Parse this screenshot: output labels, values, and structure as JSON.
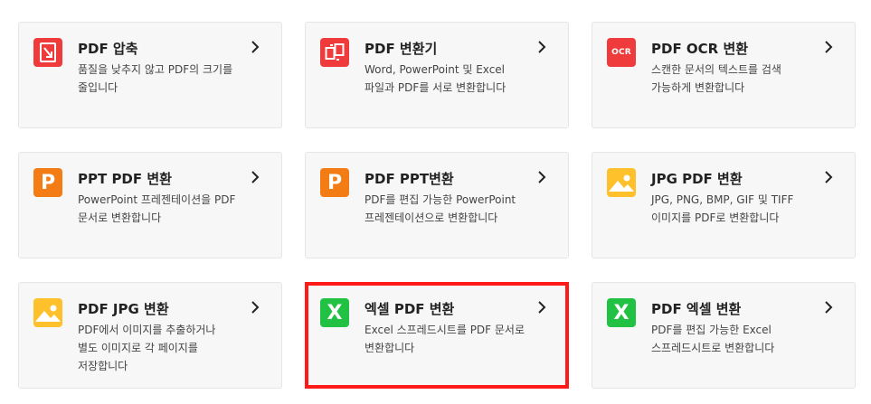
{
  "colors": {
    "red_icon": "#ef3b3b",
    "orange_icon": "#f47c14",
    "yellow_icon": "#ffc12b",
    "green_icon": "#21c243",
    "highlight_border": "#ff1a1a"
  },
  "cards": [
    {
      "title": "PDF 압축",
      "description": "품질을 낮추지 않고 PDF의 크기를 줄입니다",
      "icon": "compress-icon",
      "icon_color": "red"
    },
    {
      "title": "PDF 변환기",
      "description": "Word, PowerPoint 및 Excel 파일과 PDF를 서로 변환합니다",
      "icon": "convert-icon",
      "icon_color": "red"
    },
    {
      "title": "PDF OCR 변환",
      "description": "스캔한 문서의 텍스트를 검색 가능하게 변환합니다",
      "icon": "ocr-icon",
      "icon_color": "red",
      "icon_text": "OCR"
    },
    {
      "title": "PPT PDF 변환",
      "description": "PowerPoint 프레젠테이션을 PDF 문서로 변환합니다",
      "icon": "powerpoint-icon",
      "icon_color": "orange",
      "icon_text": "P"
    },
    {
      "title": "PDF PPT변환",
      "description": "PDF를 편집 가능한 PowerPoint 프레젠테이션으로 변환합니다",
      "icon": "powerpoint-icon",
      "icon_color": "orange",
      "icon_text": "P"
    },
    {
      "title": "JPG PDF 변환",
      "description": "JPG, PNG, BMP, GIF 및 TIFF 이미지를 PDF로 변환합니다",
      "icon": "image-icon",
      "icon_color": "yellow"
    },
    {
      "title": "PDF JPG 변환",
      "description": "PDF에서 이미지를 추출하거나 별도 이미지로 각 페이지를 저장합니다",
      "icon": "image-icon",
      "icon_color": "yellow"
    },
    {
      "title": "엑셀 PDF 변환",
      "description": "Excel 스프레드시트를 PDF 문서로 변환합니다",
      "icon": "excel-icon",
      "icon_color": "green",
      "icon_text": "X",
      "highlighted": true
    },
    {
      "title": "PDF 엑셀 변환",
      "description": "PDF를 편집 가능한 Excel 스프레드시트로 변환합니다",
      "icon": "excel-icon",
      "icon_color": "green",
      "icon_text": "X"
    }
  ]
}
